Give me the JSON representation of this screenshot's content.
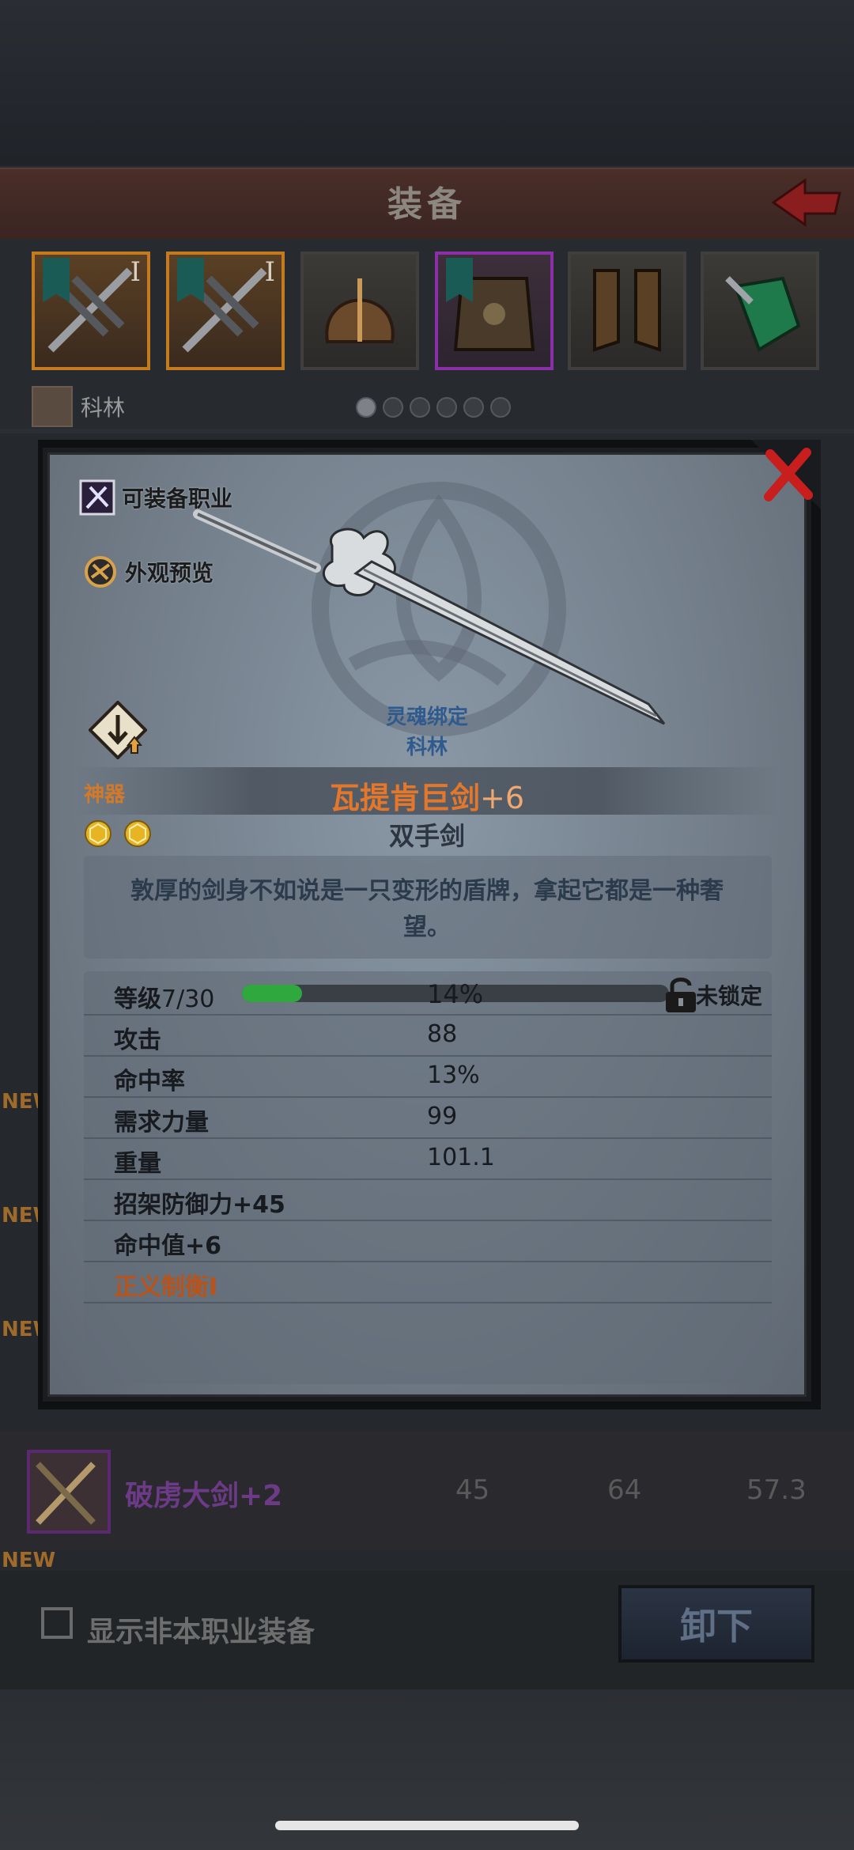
{
  "header": {
    "title": "装备"
  },
  "slots": [
    {
      "name": "weapon-slot-1",
      "roman": "I",
      "style": "orange"
    },
    {
      "name": "weapon-slot-2",
      "roman": "I",
      "style": "orange"
    },
    {
      "name": "helmet-slot",
      "roman": "",
      "style": "plain"
    },
    {
      "name": "armor-slot",
      "roman": "",
      "style": "purple"
    },
    {
      "name": "boots-slot",
      "roman": "",
      "style": "plain"
    },
    {
      "name": "accessory-slot",
      "roman": "",
      "style": "plain"
    }
  ],
  "character": {
    "name": "科林"
  },
  "pager": {
    "total": 6,
    "active": 0
  },
  "modal": {
    "equip_class_label": "可装备职业",
    "appearance_label": "外观预览",
    "soul_bound": "灵魂绑定",
    "bound_to": "科林",
    "artifact_label": "神器",
    "item_name": "瓦提肯巨剑",
    "item_plus": "+6",
    "item_type": "双手剑",
    "description": "敦厚的剑身不如说是一只变形的盾牌，拿起它都是一种奢望。",
    "level": {
      "label": "等级",
      "value": "7/30",
      "percent_text": "14%",
      "percent": 0.14
    },
    "lock_label": "未锁定",
    "stats": [
      {
        "label": "攻击",
        "value": "88"
      },
      {
        "label": "命中率",
        "value": "13%"
      },
      {
        "label": "需求力量",
        "value": "99"
      },
      {
        "label": "重量",
        "value": "101.1"
      }
    ],
    "bonuses": [
      {
        "label": "招架防御力+45",
        "highlight": false
      },
      {
        "label": "命中值+6",
        "highlight": false
      },
      {
        "label": "正义制衡I",
        "highlight": true
      }
    ]
  },
  "background_list": {
    "new_tags": [
      "NEW",
      "NEW",
      "NEW",
      "NEW"
    ],
    "row": {
      "name": "破虏大剑",
      "plus": "+2",
      "values": [
        "45",
        "64",
        "57.3"
      ]
    }
  },
  "footer": {
    "show_other_class_label": "显示非本职业装备",
    "unequip_label": "卸下"
  },
  "colors": {
    "accent_orange": "#e5772b",
    "artifact": "#d37a2a",
    "purple": "#8a2fa8",
    "progress_green": "#2fa83e"
  }
}
